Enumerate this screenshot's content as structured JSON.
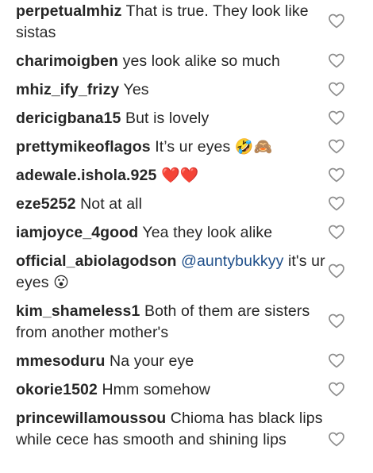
{
  "comments": [
    {
      "username": "perpetualmhiz",
      "pre": " ",
      "text": "That is true. They look like sistas",
      "mention": "",
      "post": "",
      "emoji": ""
    },
    {
      "username": "charimoigben",
      "pre": " ",
      "text": "yes look alike so much",
      "mention": "",
      "post": "",
      "emoji": ""
    },
    {
      "username": "mhiz_ify_frizy",
      "pre": " ",
      "text": "Yes",
      "mention": "",
      "post": "",
      "emoji": ""
    },
    {
      "username": "dericigbana15",
      "pre": " ",
      "text": "But is lovely",
      "mention": "",
      "post": "",
      "emoji": ""
    },
    {
      "username": "prettymikeoflagos",
      "pre": " ",
      "text": "It’s ur eyes ",
      "mention": "",
      "post": "",
      "emoji": "🤣🙈"
    },
    {
      "username": "adewale.ishola.925",
      "pre": " ",
      "text": "",
      "mention": "",
      "post": "",
      "emoji": "❤️❤️"
    },
    {
      "username": "eze5252",
      "pre": " ",
      "text": "Not at all",
      "mention": "",
      "post": "",
      "emoji": ""
    },
    {
      "username": "iamjoyce_4good",
      "pre": " ",
      "text": "Yea they look alike",
      "mention": "",
      "post": "",
      "emoji": ""
    },
    {
      "username": "official_abiolagodson",
      "pre": " ",
      "text": "",
      "mention": "@auntybukkyy",
      "post": " it's ur eyes ",
      "emoji": "😮"
    },
    {
      "username": "kim_shameless1",
      "pre": " ",
      "text": "Both of them are sisters from another mother's",
      "mention": "",
      "post": "",
      "emoji": ""
    },
    {
      "username": "mmesoduru",
      "pre": " ",
      "text": "Na your eye",
      "mention": "",
      "post": "",
      "emoji": ""
    },
    {
      "username": "okorie1502",
      "pre": " ",
      "text": "Hmm somehow",
      "mention": "",
      "post": "",
      "emoji": ""
    },
    {
      "username": "princewillamoussou",
      "pre": " ",
      "text": "Chioma has black lips while cece has smooth and shining lips",
      "mention": "",
      "post": "",
      "emoji": ""
    }
  ],
  "like_icon": "heart-outline-icon",
  "colors": {
    "text": "#262626",
    "mention": "#1f4f8a",
    "icon": "#8e8e8e",
    "background": "#ffffff"
  }
}
